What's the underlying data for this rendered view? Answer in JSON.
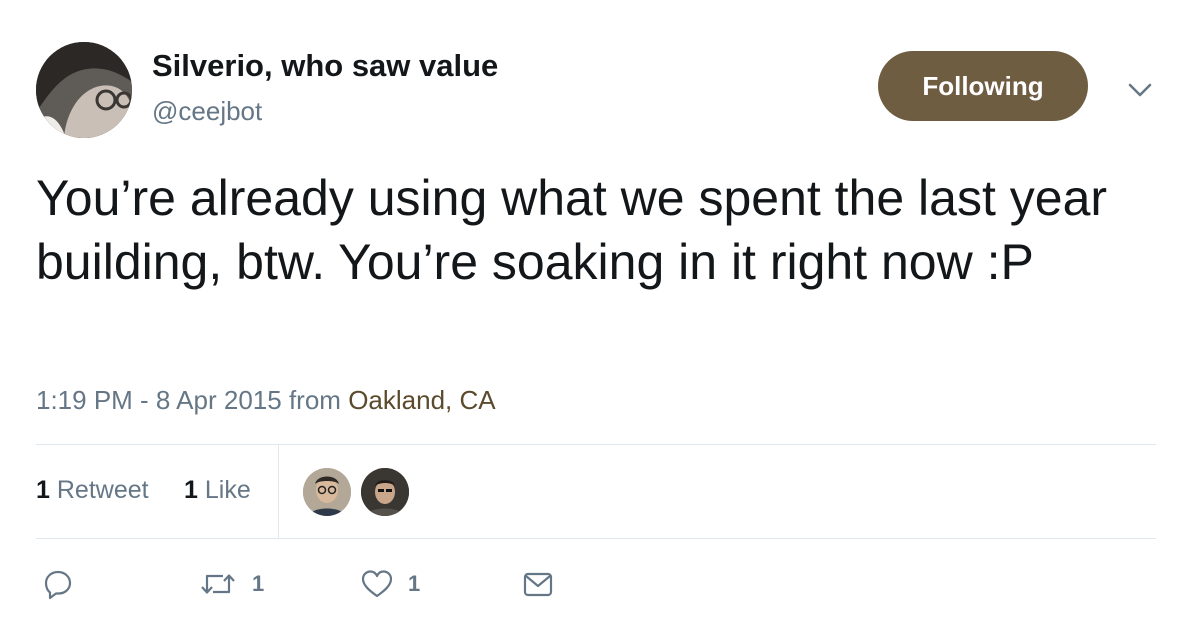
{
  "author": {
    "name": "Silverio, who saw value",
    "handle": "@ceejbot"
  },
  "follow_button": {
    "label": "Following",
    "color": "#6f5d42"
  },
  "tweet": {
    "text": "You’re already using what we spent the last year building, btw. You’re soaking in it right now :P"
  },
  "meta": {
    "timestamp": "1:19 PM - 8 Apr 2015",
    "from_label": "from",
    "place": "Oakland, CA"
  },
  "stats": {
    "retweets_count": "1",
    "retweets_label": "Retweet",
    "likes_count": "1",
    "likes_label": "Like"
  },
  "actions": {
    "reply_icon": "reply-icon",
    "retweet_icon": "retweet-icon",
    "retweet_count": "1",
    "like_icon": "heart-icon",
    "like_count": "1",
    "dm_icon": "envelope-icon"
  }
}
